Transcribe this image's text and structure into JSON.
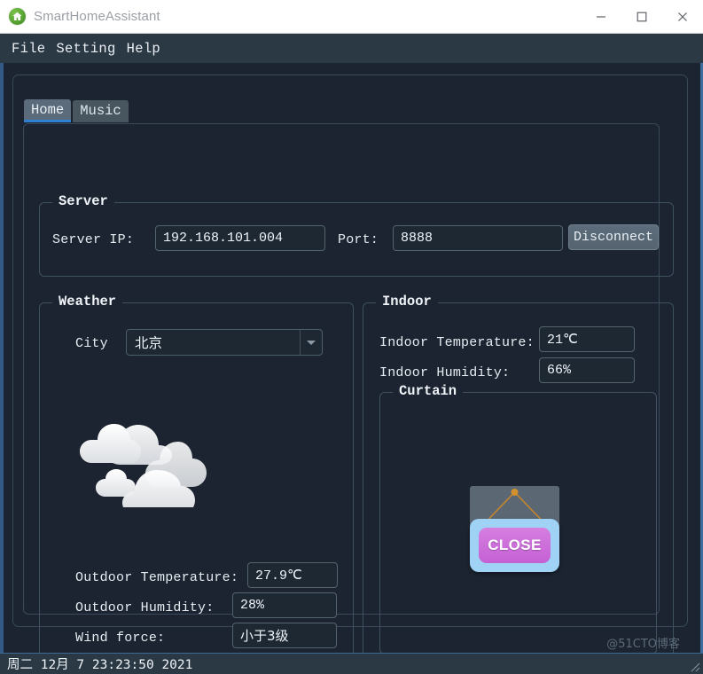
{
  "window": {
    "title": "SmartHomeAssistant",
    "app_icon": "home-icon",
    "controls": {
      "minimize": "minimize-icon",
      "maximize": "maximize-icon",
      "close": "close-icon"
    }
  },
  "menubar": {
    "items": [
      {
        "label": "File"
      },
      {
        "label": "Setting"
      },
      {
        "label": "Help"
      }
    ]
  },
  "tabs": [
    {
      "label": "Home",
      "active": true
    },
    {
      "label": "Music",
      "active": false
    }
  ],
  "server": {
    "group_title": "Server",
    "ip_label": "Server IP:",
    "ip_value": "192.168.101.004",
    "port_label": "Port:",
    "port_value": "8888",
    "button_label": "Disconnect"
  },
  "weather": {
    "group_title": "Weather",
    "city_label": "City",
    "city_value": "北京",
    "icon": "cloudy-weather-icon",
    "outdoor_temperature_label": "Outdoor Temperature:",
    "outdoor_temperature_value": "27.9℃",
    "outdoor_humidity_label": "Outdoor Humidity:",
    "outdoor_humidity_value": "28%",
    "wind_force_label": "Wind force:",
    "wind_force_value": "小于3级"
  },
  "indoor": {
    "group_title": "Indoor",
    "temperature_label": "Indoor Temperature:",
    "temperature_value": "21℃",
    "humidity_label": "Indoor Humidity:",
    "humidity_value": "66%"
  },
  "curtain": {
    "group_title": "Curtain",
    "state_label": "CLOSE"
  },
  "statusbar": {
    "datetime": "周二 12月  7 23:23:50 2021",
    "watermark": "@51CTO博客"
  },
  "colors": {
    "window_bg": "#1b2430",
    "menubar_bg": "#2b3945",
    "accent_blue": "#2f7fd0",
    "edge_blue": "#3f6d9e",
    "curtain_plate": "#c560d4",
    "curtain_frame": "#9fd2f5",
    "app_icon_green": "#4f9b2e"
  }
}
